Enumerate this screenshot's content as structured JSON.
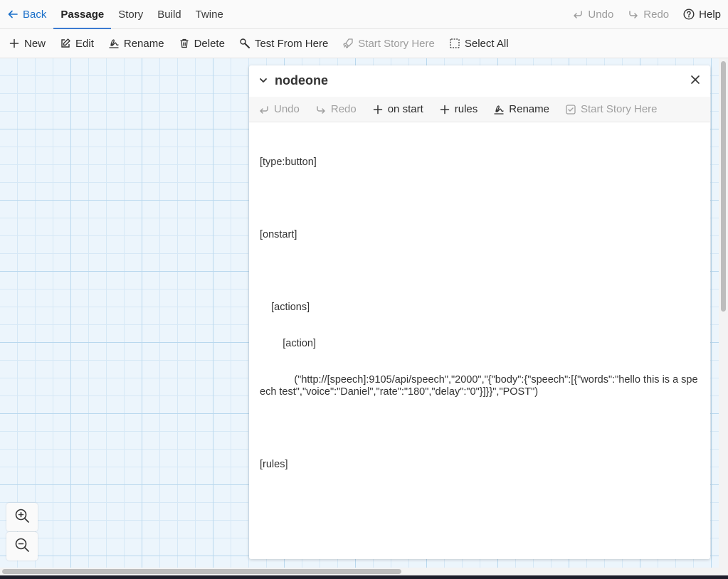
{
  "topbar": {
    "back_label": "Back",
    "tabs": [
      {
        "label": "Passage",
        "active": true
      },
      {
        "label": "Story",
        "active": false
      },
      {
        "label": "Build",
        "active": false
      },
      {
        "label": "Twine",
        "active": false
      }
    ],
    "undo_label": "Undo",
    "redo_label": "Redo",
    "help_label": "Help"
  },
  "toolbar": {
    "new_label": "New",
    "edit_label": "Edit",
    "rename_label": "Rename",
    "delete_label": "Delete",
    "test_label": "Test From Here",
    "start_label": "Start Story Here",
    "select_all_label": "Select All"
  },
  "dialog": {
    "title": "nodeone",
    "toolbar": {
      "undo_label": "Undo",
      "redo_label": "Redo",
      "on_start_label": "on start",
      "rules_label": "rules",
      "rename_label": "Rename",
      "start_label": "Start Story Here"
    },
    "lines": [
      "[type:button]",
      "",
      "[onstart]",
      "",
      "    [actions]",
      "        [action]",
      "            (\"http://[speech]:9105/api/speech\",\"2000\",\"{\"body\":{\"speech\":[{\"words\":\"hello this is a speech test\",\"voice\":\"Daniel\",\"rate\":\"180\",\"delay\":\"0\"}]}}\",\"POST\")",
      "",
      "[rules]"
    ]
  },
  "colors": {
    "accent": "#3b7bd1",
    "link": "#1a6fc9",
    "canvas": "#ecf5fc",
    "disabled": "#9c9c9c"
  }
}
